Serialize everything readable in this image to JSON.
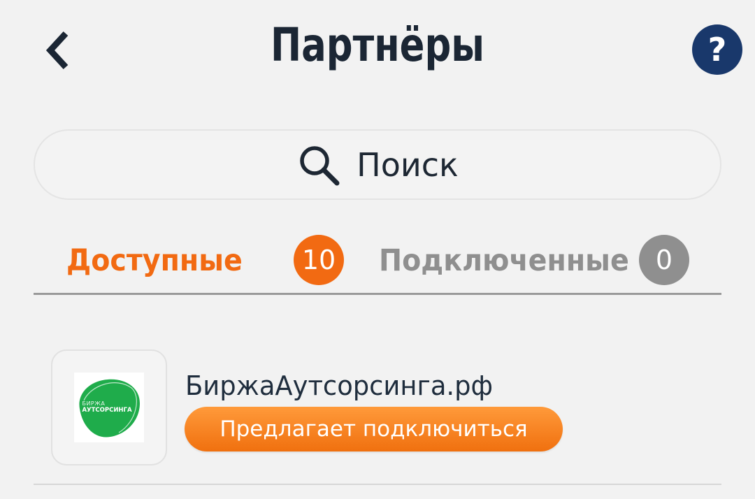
{
  "header": {
    "title": "Партнёры",
    "help_label": "?"
  },
  "search": {
    "placeholder": "Поиск"
  },
  "tabs": [
    {
      "label": "Доступные",
      "count": "10",
      "active": true
    },
    {
      "label": "Подключенные",
      "count": "0",
      "active": false
    }
  ],
  "partners": [
    {
      "name": "БиржаАутсорсинга.рф",
      "logo_line1": "БИРЖА",
      "logo_line2": "АУТСОРСИНГА",
      "status": "Предлагает подключиться"
    }
  ],
  "colors": {
    "accent": "#f26a12",
    "inactive": "#8f8f8f",
    "help_bg": "#19386b",
    "title": "#1b2634",
    "logo_green": "#1fac4b"
  },
  "icons": {
    "back": "chevron-left-icon",
    "search": "search-icon",
    "help": "question-icon"
  }
}
